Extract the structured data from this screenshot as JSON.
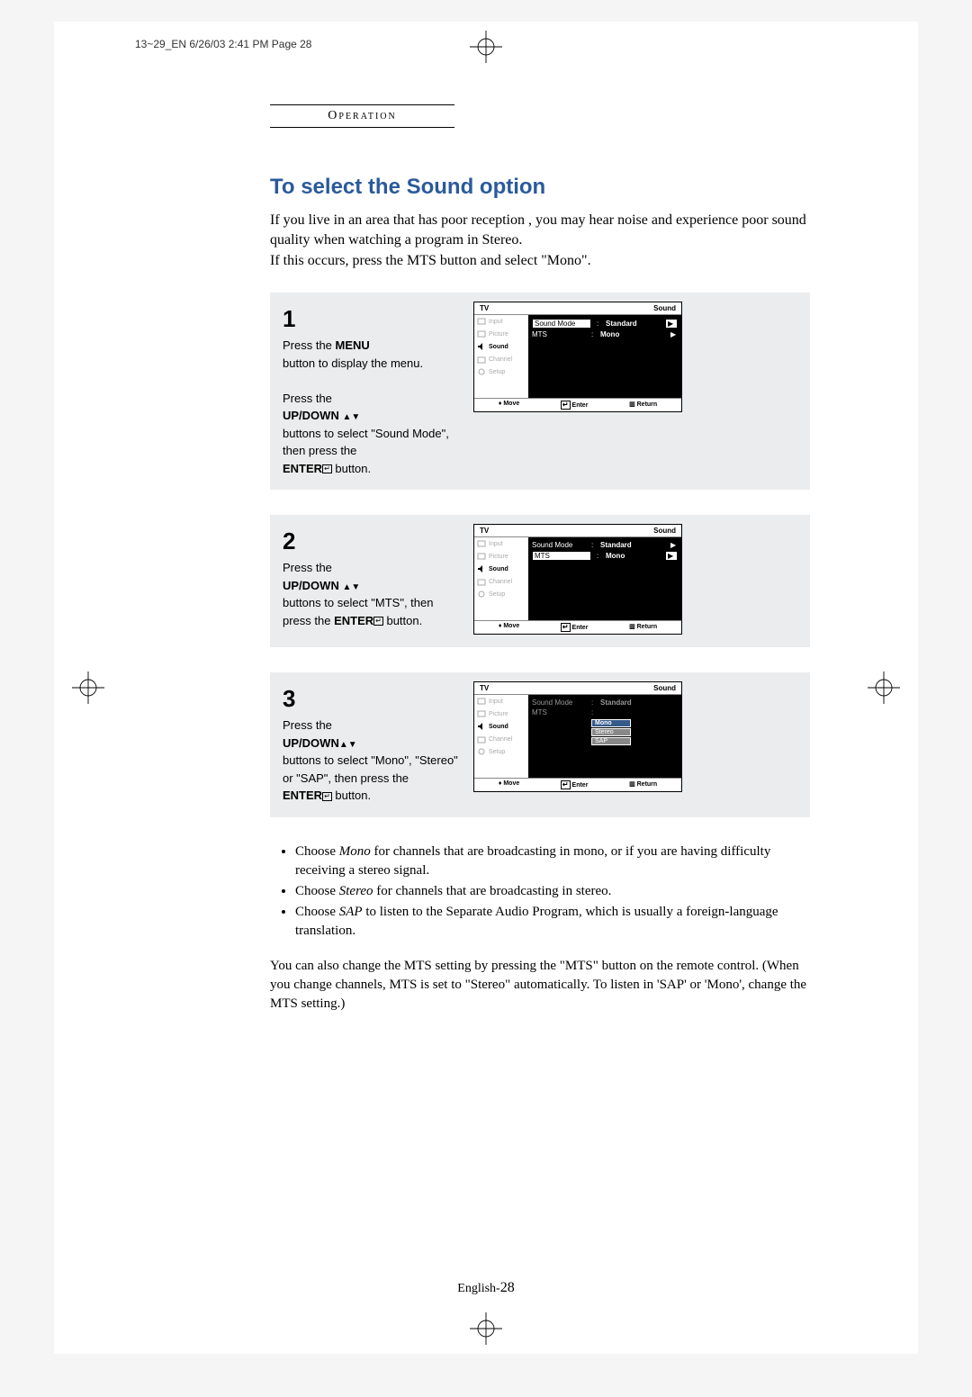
{
  "meta": {
    "header": "13~29_EN  6/26/03 2:41 PM  Page 28",
    "section": "Operation",
    "page_label": "English-",
    "page_num": "28"
  },
  "title": "To select the Sound option",
  "intro": [
    "If you live in an area that has poor reception , you may hear noise and experience poor sound quality when watching a program in Stereo.",
    "If this occurs, press the MTS button and select \"Mono\"."
  ],
  "steps": [
    {
      "num": "1",
      "text": {
        "line1a": "Press the ",
        "line1b": "MENU",
        "line2": "button to display the menu.",
        "line3a": "Press the",
        "line3b": "UP/DOWN ",
        "line4": "buttons to select \"Sound Mode\", then press the",
        "line5a": "ENTER",
        "line5b": "  button."
      },
      "osd": {
        "title_left": "TV",
        "title_right": "Sound",
        "side_active": "Sound",
        "rows": [
          {
            "label": "Sound Mode",
            "value": "Standard",
            "boxed": true
          },
          {
            "label": "MTS",
            "value": "Mono",
            "boxed": false
          }
        ],
        "foot": [
          "Move",
          "Enter",
          "Return"
        ]
      }
    },
    {
      "num": "2",
      "text": {
        "line1a": "Press the",
        "line1b": "UP/DOWN ",
        "line2": "buttons to select \"MTS\", then press the ",
        "line3a": "ENTER",
        "line3b": "  button."
      },
      "osd": {
        "title_left": "TV",
        "title_right": "Sound",
        "side_active": "Sound",
        "rows": [
          {
            "label": "Sound Mode",
            "value": "Standard",
            "boxed": false
          },
          {
            "label": "MTS",
            "value": "Mono",
            "boxed": true
          }
        ],
        "foot": [
          "Move",
          "Enter",
          "Return"
        ]
      }
    },
    {
      "num": "3",
      "text": {
        "line1a": "Press the",
        "line1b": "UP/DOWN",
        "line2": "buttons to select \"Mono\", \"Stereo\" or \"SAP\", then press the",
        "line3a": "ENTER",
        "line3b": "  button."
      },
      "osd": {
        "title_left": "TV",
        "title_right": "Sound",
        "side_active": "Sound",
        "rows_plain": [
          {
            "label": "Sound Mode",
            "value": "Standard"
          },
          {
            "label": "MTS",
            "value": ""
          }
        ],
        "dropdown": [
          "Mono",
          "Stereo",
          "SAP"
        ],
        "foot": [
          "Move",
          "Enter",
          "Return"
        ]
      }
    }
  ],
  "side_items": [
    "Input",
    "Picture",
    "Sound",
    "Channel",
    "Setup"
  ],
  "bullets": [
    {
      "pre": "Choose ",
      "em": "Mono",
      "post": " for channels that are broadcasting in mono, or if you are having difficulty receiving a stereo signal."
    },
    {
      "pre": "Choose ",
      "em": "Stereo",
      "post": " for channels that are broadcasting in stereo."
    },
    {
      "pre": "Choose ",
      "em": "SAP",
      "post": " to listen to the Separate Audio Program, which is usually a foreign-language translation."
    }
  ],
  "notes": "You can also change the MTS setting by pressing the \"MTS\" button on the remote control. (When you change channels, MTS is set to \"Stereo\" automatically. To listen in 'SAP' or 'Mono', change the MTS setting.)"
}
